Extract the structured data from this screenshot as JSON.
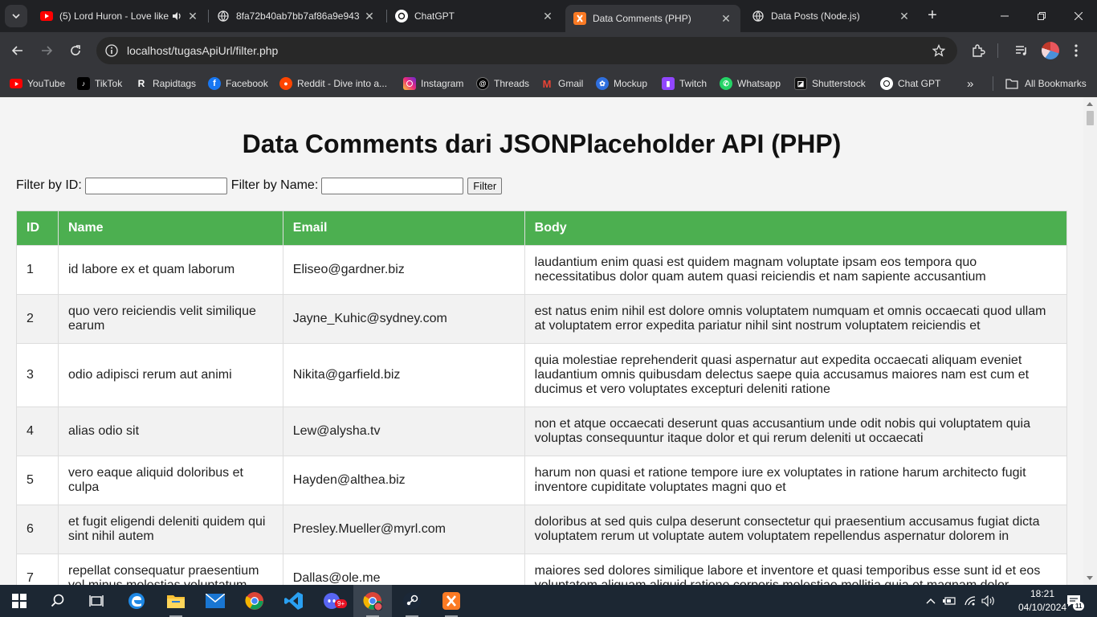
{
  "browser": {
    "tabs": [
      {
        "title": "(5) Lord Huron - Love like",
        "has_audio": true,
        "favicon": "youtube-icon"
      },
      {
        "title": "8fa72b40ab7bb7af86a9e943",
        "favicon": "globe-icon"
      },
      {
        "title": "ChatGPT",
        "favicon": "chatgpt-icon"
      },
      {
        "title": "Data Comments (PHP)",
        "favicon": "xampp-icon",
        "active": true
      },
      {
        "title": "Data Posts (Node.js)",
        "favicon": "globe-icon"
      }
    ],
    "url": "localhost/tugasApiUrl/filter.php",
    "bookmarks": [
      {
        "label": "YouTube",
        "icon": "youtube-icon",
        "color": "#ff0000"
      },
      {
        "label": "TikTok",
        "icon": "tiktok-icon",
        "color": "#000000"
      },
      {
        "label": "Rapidtags",
        "icon": "rapidtags-icon",
        "color": "#111111"
      },
      {
        "label": "Facebook",
        "icon": "facebook-icon",
        "color": "#1877f2"
      },
      {
        "label": "Reddit - Dive into a...",
        "icon": "reddit-icon",
        "color": "#ff4500"
      },
      {
        "label": "Instagram",
        "icon": "instagram-icon",
        "color": "#d6249f"
      },
      {
        "label": "Threads",
        "icon": "threads-icon",
        "color": "#000000"
      },
      {
        "label": "Gmail",
        "icon": "gmail-icon",
        "color": "#ea4335"
      },
      {
        "label": "Mockup",
        "icon": "mockup-icon",
        "color": "#2f6fde"
      },
      {
        "label": "Twitch",
        "icon": "twitch-icon",
        "color": "#9146ff"
      },
      {
        "label": "Whatsapp",
        "icon": "whatsapp-icon",
        "color": "#25d366"
      },
      {
        "label": "Shutterstock",
        "icon": "shutterstock-icon",
        "color": "#111111"
      },
      {
        "label": "Chat GPT",
        "icon": "chatgpt-icon",
        "color": "#ffffff"
      }
    ],
    "all_bookmarks_label": "All Bookmarks"
  },
  "page": {
    "title": "Data Comments dari JSONPlaceholder API (PHP)",
    "filter": {
      "id_label": "Filter by ID:",
      "id_value": "",
      "name_label": "Filter by Name:",
      "name_value": "",
      "button_label": "Filter"
    },
    "table": {
      "headers": [
        "ID",
        "Name",
        "Email",
        "Body"
      ],
      "rows": [
        {
          "id": "1",
          "name": "id labore ex et quam laborum",
          "email": "Eliseo@gardner.biz",
          "body": "laudantium enim quasi est quidem magnam voluptate ipsam eos tempora quo necessitatibus dolor quam autem quasi reiciendis et nam sapiente accusantium"
        },
        {
          "id": "2",
          "name": "quo vero reiciendis velit similique earum",
          "email": "Jayne_Kuhic@sydney.com",
          "body": "est natus enim nihil est dolore omnis voluptatem numquam et omnis occaecati quod ullam at voluptatem error expedita pariatur nihil sint nostrum voluptatem reiciendis et"
        },
        {
          "id": "3",
          "name": "odio adipisci rerum aut animi",
          "email": "Nikita@garfield.biz",
          "body": "quia molestiae reprehenderit quasi aspernatur aut expedita occaecati aliquam eveniet laudantium omnis quibusdam delectus saepe quia accusamus maiores nam est cum et ducimus et vero voluptates excepturi deleniti ratione"
        },
        {
          "id": "4",
          "name": "alias odio sit",
          "email": "Lew@alysha.tv",
          "body": "non et atque occaecati deserunt quas accusantium unde odit nobis qui voluptatem quia voluptas consequuntur itaque dolor et qui rerum deleniti ut occaecati"
        },
        {
          "id": "5",
          "name": "vero eaque aliquid doloribus et culpa",
          "email": "Hayden@althea.biz",
          "body": "harum non quasi et ratione tempore iure ex voluptates in ratione harum architecto fugit inventore cupiditate voluptates magni quo et"
        },
        {
          "id": "6",
          "name": "et fugit eligendi deleniti quidem qui sint nihil autem",
          "email": "Presley.Mueller@myrl.com",
          "body": "doloribus at sed quis culpa deserunt consectetur qui praesentium accusamus fugiat dicta voluptatem rerum ut voluptate autem voluptatem repellendus aspernatur dolorem in"
        },
        {
          "id": "7",
          "name": "repellat consequatur praesentium vel minus molestias voluptatum",
          "email": "Dallas@ole.me",
          "body": "maiores sed dolores similique labore et inventore et quasi temporibus esse sunt id et eos voluptatem aliquam aliquid ratione corporis molestiae mollitia quia et magnam dolor"
        }
      ]
    }
  },
  "taskbar": {
    "apps": [
      "start-icon",
      "search-icon",
      "task-view-icon",
      "edge-icon",
      "file-explorer-icon",
      "mail-icon",
      "chrome-icon",
      "vscode-icon",
      "discord-icon",
      "chrome-profile-icon",
      "steam-icon",
      "xampp-icon"
    ],
    "discord_badge": "9+",
    "time": "18:21",
    "date": "04/10/2024",
    "notification_count": "11"
  },
  "colors": {
    "table_header": "#4caf50",
    "page_bg": "#f4f4f4",
    "chrome_dark": "#202124"
  }
}
